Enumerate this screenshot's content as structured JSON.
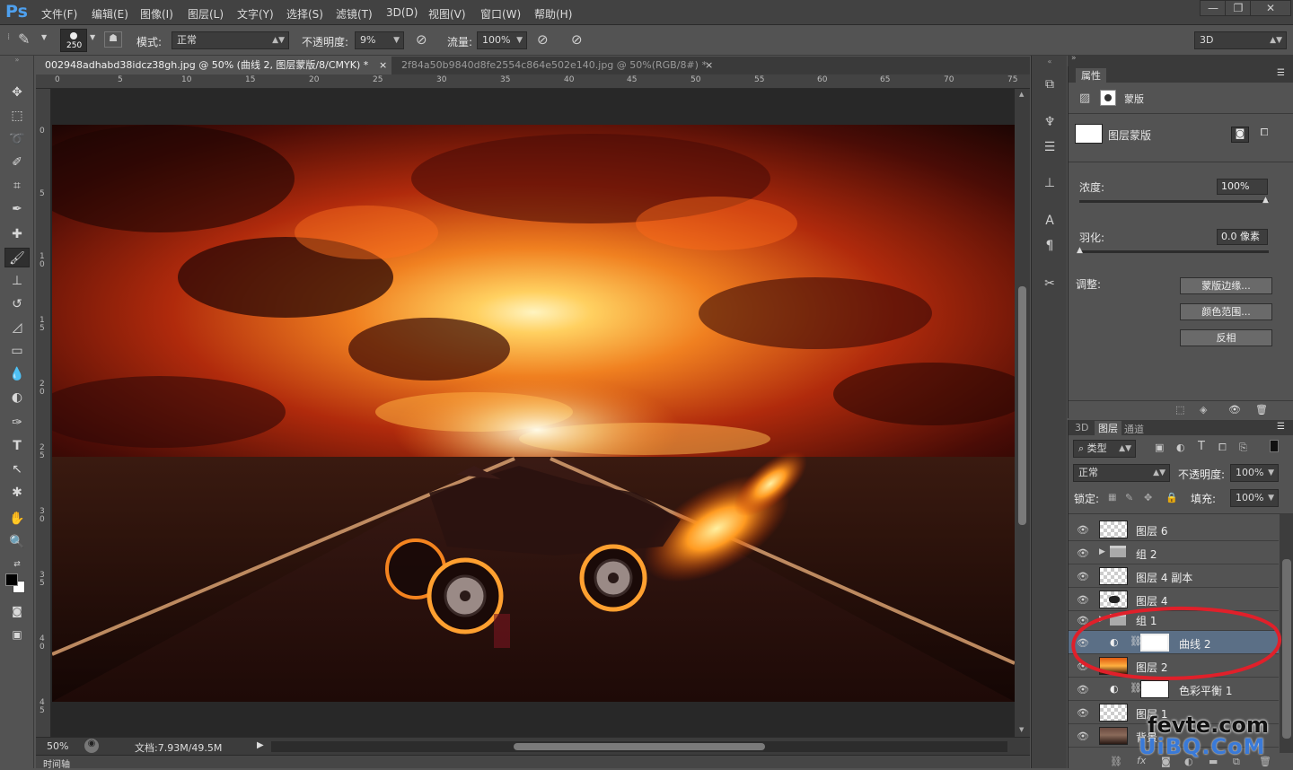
{
  "app": {
    "logo": "Ps"
  },
  "menu": [
    "文件(F)",
    "编辑(E)",
    "图像(I)",
    "图层(L)",
    "文字(Y)",
    "选择(S)",
    "滤镜(T)",
    "3D(D)",
    "视图(V)",
    "窗口(W)",
    "帮助(H)"
  ],
  "window": {
    "minimize": "—",
    "restore": "❐",
    "close": "✕"
  },
  "options": {
    "brush_size": "250",
    "mode_label": "模式:",
    "mode_value": "正常",
    "opacity_label": "不透明度:",
    "opacity_value": "9%",
    "flow_label": "流量:",
    "flow_value": "100%",
    "workspace": "3D"
  },
  "tabs": [
    {
      "label": "002948adhabd38idcz38gh.jpg @ 50% (曲线 2, 图层蒙版/8/CMYK) *",
      "close": "×",
      "active": true
    },
    {
      "label": "2f84a50b9840d8fe2554c864e502e140.jpg @ 50%(RGB/8#) *",
      "close": "×",
      "active": false
    }
  ],
  "ruler_top": [
    "0",
    "5",
    "10",
    "15",
    "20",
    "25",
    "30",
    "35",
    "40",
    "45",
    "50",
    "55",
    "60",
    "65",
    "70",
    "75"
  ],
  "ruler_left": [
    "0",
    "5",
    "1 0",
    "1 5",
    "2 0",
    "2 5",
    "3 0",
    "3 5",
    "4 0",
    "4 5"
  ],
  "status": {
    "zoom": "50%",
    "doc": "文档:7.93M/49.5M",
    "timeline": "时间轴"
  },
  "properties": {
    "tab": "属性",
    "section": "蒙版",
    "mask_type": "图层蒙版",
    "density_label": "浓度:",
    "density_value": "100%",
    "feather_label": "羽化:",
    "feather_value": "0.0 像素",
    "adjust_label": "调整:",
    "btn_edge": "蒙版边缘...",
    "btn_color_range": "颜色范围...",
    "btn_invert": "反相"
  },
  "layers_panel": {
    "tabs": [
      "3D",
      "图层",
      "通道"
    ],
    "filter_label": "类型",
    "blend_mode": "正常",
    "opacity_label": "不透明度:",
    "opacity_value": "100%",
    "lock_label": "锁定:",
    "fill_label": "填充:",
    "fill_value": "100%",
    "layers": [
      {
        "name": "图层 6",
        "type": "layer"
      },
      {
        "name": "组 2",
        "type": "group"
      },
      {
        "name": "图层 4 副本",
        "type": "layer"
      },
      {
        "name": "图层 4",
        "type": "layer"
      },
      {
        "name": "组 1",
        "type": "group"
      },
      {
        "name": "曲线 2",
        "type": "adjustment",
        "selected": true
      },
      {
        "name": "图层 2",
        "type": "layer"
      },
      {
        "name": "色彩平衡 1",
        "type": "adjustment"
      },
      {
        "name": "图层 1",
        "type": "layer"
      },
      {
        "name": "背景",
        "type": "layer"
      }
    ]
  },
  "watermark": {
    "line1": "fevte.com",
    "line2": "UiBQ.CoM"
  },
  "colors": {
    "accent": "#4ea0ee",
    "annotation": "#e0202a",
    "selected_row": "#5b6f86"
  }
}
